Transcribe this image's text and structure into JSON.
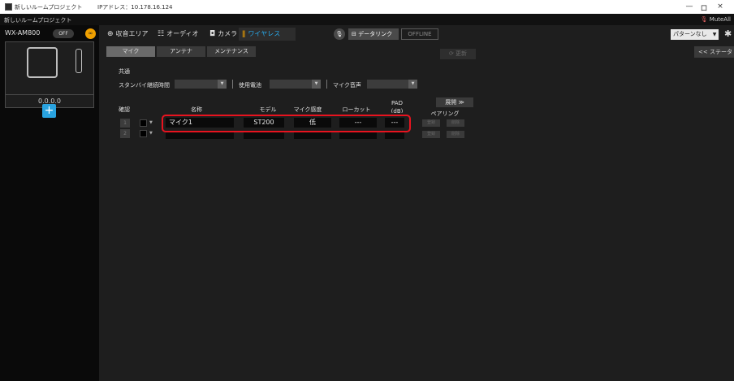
{
  "titlebar": {
    "title": "新しいルームプロジェクト",
    "ip": "IPアドレス：10.178.16.124",
    "minimize": "—",
    "maximize": "ロ",
    "close": "×"
  },
  "projbar": {
    "project": "新しいルームプロジェクト",
    "mute": "MuteAll"
  },
  "sidebar": {
    "device_name": "WX-AM800",
    "off_label": "OFF",
    "device_ip": "0.0.0.0",
    "add_label": "+"
  },
  "nav": {
    "tabs": [
      {
        "label": "収音エリア",
        "icon": "area-icon"
      },
      {
        "label": "オーディオ",
        "icon": "audio-icon"
      },
      {
        "label": "カメラ",
        "icon": "camera-icon"
      },
      {
        "label": "ワイヤレス",
        "icon": "wireless-icon",
        "active": true
      }
    ],
    "datalink": "データリンク",
    "offline": "OFFLINE",
    "pattern": "パターンなし",
    "status_button": "<< ステータ"
  },
  "subtabs": [
    {
      "label": "マイク",
      "active": true
    },
    {
      "label": "アンテナ"
    },
    {
      "label": "メンテナンス"
    }
  ],
  "update_button": "更新",
  "common": {
    "heading": "共通",
    "standby_label": "スタンバイ継続時間",
    "battery_label": "使用電池",
    "mic_sound_label": "マイク音声"
  },
  "table": {
    "expand_label": "展開 ≫",
    "headers": {
      "check": "確認",
      "name": "名称",
      "model": "モデル",
      "sensitivity": "マイク感度",
      "lowcut": "ローカット",
      "pad": "PAD",
      "pad_unit": "(dB)",
      "pairing": "ペアリング"
    },
    "rows": [
      {
        "num": "1",
        "name": "マイク1",
        "model": "ST200",
        "sensitivity": "低",
        "lowcut": "---",
        "pad": "---",
        "pair1": "登録",
        "pair2": "削除"
      },
      {
        "num": "2",
        "name": "",
        "model": "",
        "sensitivity": "",
        "lowcut": "",
        "pad": "",
        "pair1": "登録",
        "pair2": "削除"
      }
    ]
  },
  "colors": {
    "accent": "#28a8e8",
    "highlight": "#e8131f",
    "orange": "#f0a000"
  }
}
